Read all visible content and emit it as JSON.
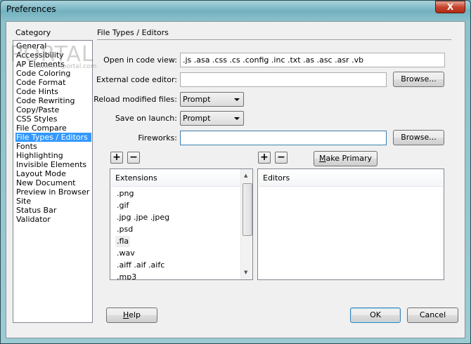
{
  "window": {
    "title": "Preferences",
    "close_label": "X"
  },
  "category": {
    "label": "Category",
    "items": [
      "General",
      "Accessibility",
      "AP Elements",
      "Code Coloring",
      "Code Format",
      "Code Hints",
      "Code Rewriting",
      "Copy/Paste",
      "CSS Styles",
      "File Compare",
      "File Types / Editors",
      "Fonts",
      "Highlighting",
      "Invisible Elements",
      "Layout Mode",
      "New Document",
      "Preview in Browser",
      "Site",
      "Status Bar",
      "Validator"
    ],
    "selected": "File Types / Editors"
  },
  "watermark": {
    "text": "PORTAL",
    "url": "www.softportal.com"
  },
  "section": {
    "title": "File Types / Editors"
  },
  "form": {
    "open_in_code_view": {
      "label": "Open in code view:",
      "value": ".js .asa .css .cs .config .inc .txt .as .asc .asr .vb"
    },
    "external_code_editor": {
      "label": "External code editor:",
      "value": ""
    },
    "reload_modified_files": {
      "label": "Reload modified files:",
      "value": "Prompt"
    },
    "save_on_launch": {
      "label": "Save on launch:",
      "value": "Prompt"
    },
    "fireworks": {
      "label": "Fireworks:",
      "value": ""
    },
    "browse_label": "Browse..."
  },
  "extensions": {
    "header": "Extensions",
    "items": [
      ".png",
      ".gif",
      ".jpg .jpe .jpeg",
      ".psd",
      ".fla",
      ".wav",
      ".aiff .aif .aifc",
      ".mp3"
    ],
    "highlighted": ".fla"
  },
  "editors": {
    "header": "Editors",
    "items": []
  },
  "buttons": {
    "add": "+",
    "remove": "−",
    "make_primary": "Make Primary",
    "help": "Help",
    "ok": "OK",
    "cancel": "Cancel"
  }
}
